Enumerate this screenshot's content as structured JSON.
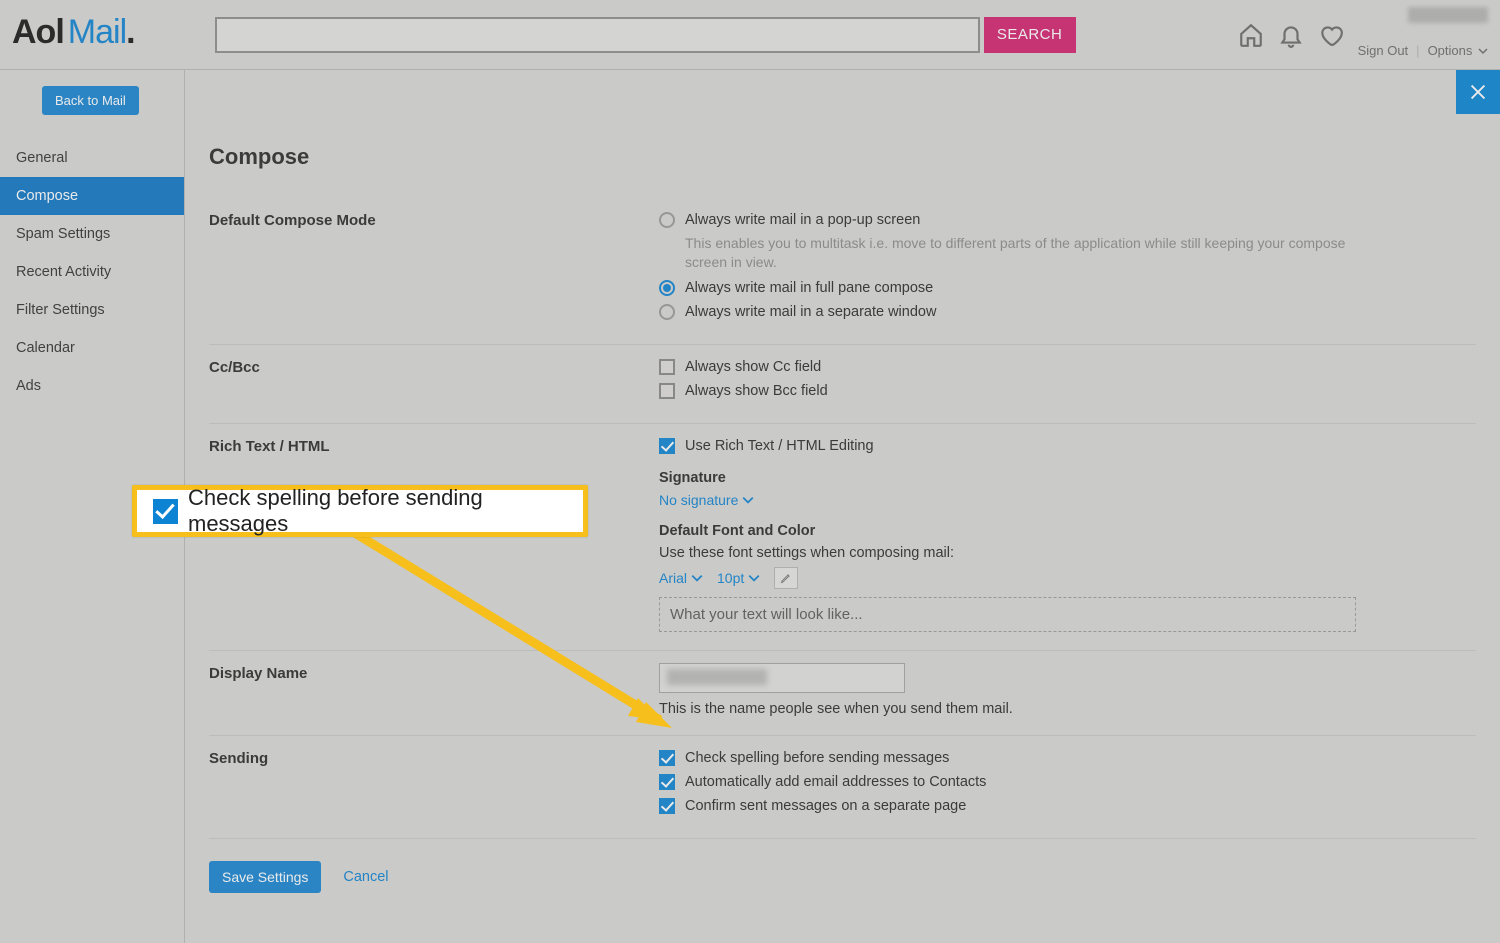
{
  "brand": {
    "part1": "Aol",
    "part2": "Mail",
    "dot": "."
  },
  "search": {
    "placeholder": "",
    "button": "SEARCH"
  },
  "header": {
    "sign_out": "Sign Out",
    "options": "Options"
  },
  "sidebar": {
    "back": "Back to Mail",
    "items": [
      "General",
      "Compose",
      "Spam Settings",
      "Recent Activity",
      "Filter Settings",
      "Calendar",
      "Ads"
    ],
    "active_index": 1
  },
  "page": {
    "title": "Compose"
  },
  "compose_mode": {
    "label": "Default Compose Mode",
    "options": [
      {
        "text": "Always write mail in a pop-up screen",
        "help": "This enables you to multitask i.e. move to different parts of the application while still keeping your compose screen in view.",
        "checked": false
      },
      {
        "text": "Always write mail in full pane compose",
        "checked": true
      },
      {
        "text": "Always write mail in a separate window",
        "checked": false
      }
    ]
  },
  "ccbcc": {
    "label": "Cc/Bcc",
    "options": [
      {
        "text": "Always show Cc field",
        "checked": false
      },
      {
        "text": "Always show Bcc field",
        "checked": false
      }
    ]
  },
  "richtext": {
    "label": "Rich Text / HTML",
    "use_rich": "Use Rich Text / HTML Editing",
    "signature_heading": "Signature",
    "signature_value": "No signature",
    "font_heading": "Default Font and Color",
    "font_help": "Use these font settings when composing mail:",
    "font_family": "Arial",
    "font_size": "10pt",
    "preview_text": "What your text will look like..."
  },
  "display_name": {
    "label": "Display Name",
    "help": "This is the name people see when you send them mail."
  },
  "sending": {
    "label": "Sending",
    "options": [
      {
        "text": "Check spelling before sending messages",
        "checked": true
      },
      {
        "text": "Automatically add email addresses to Contacts",
        "checked": true
      },
      {
        "text": "Confirm sent messages on a separate page",
        "checked": true
      }
    ]
  },
  "footer": {
    "save": "Save Settings",
    "cancel": "Cancel"
  },
  "callout": {
    "text": "Check spelling before sending messages"
  }
}
